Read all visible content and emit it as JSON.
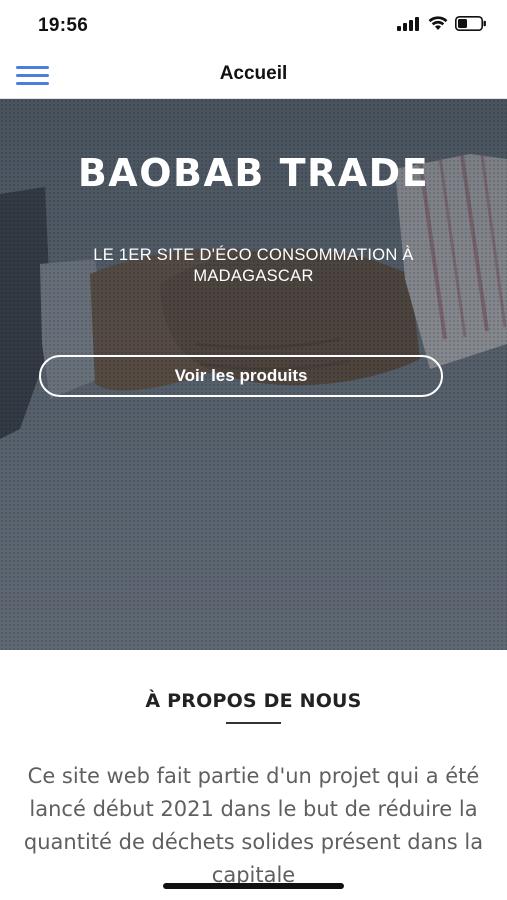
{
  "status_bar": {
    "time": "19:56",
    "icons": [
      "signal-icon",
      "wifi-icon",
      "battery-icon"
    ]
  },
  "nav": {
    "menu_icon": "hamburger-menu-icon",
    "title": "Accueil"
  },
  "hero": {
    "title": "BAOBAB TRADE",
    "subtitle": "LE 1ER SITE D'ÉCO CONSOMMATION À MADAGASCAR",
    "button_label": "Voir les produits",
    "background_image": "handshake-photo"
  },
  "about": {
    "title": "À PROPOS DE NOUS",
    "text": "Ce site web fait partie d'un projet qui a été lancé début 2021 dans le but de réduire la quantité de déchets solides présent dans la capitale"
  },
  "colors": {
    "accent": "#4a7fe0",
    "hero_overlay": "#545e69",
    "text_body": "#5f5f5f"
  }
}
